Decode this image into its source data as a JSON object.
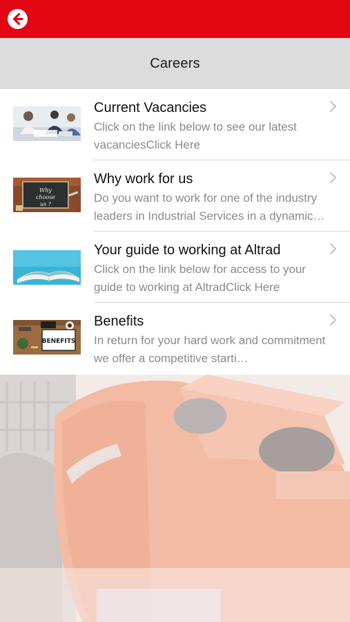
{
  "header": {
    "back_icon": "back-arrow-icon",
    "brand_color": "#e30613"
  },
  "page": {
    "title": "Careers"
  },
  "items": [
    {
      "title": "Current Vacancies",
      "description": "Click on the link below to see our latest vacanciesClick Here",
      "thumb": "meeting-photo"
    },
    {
      "title": "Why work for us",
      "description": "Do you want to work for one of the industry leaders in Industrial Services in a dynamic…",
      "thumb": "chalkboard-photo",
      "thumb_text": "Why choose us ?"
    },
    {
      "title": "Your guide to working at Altrad",
      "description": "Click on the link below for access to your guide to working at AltradClick Here",
      "thumb": "open-book-photo"
    },
    {
      "title": "Benefits",
      "description": "In return for your hard work and commitment we offer a competitive starti…",
      "thumb": "benefits-desk-photo",
      "thumb_text": "BENEFITS"
    }
  ],
  "icons": {
    "chevron": "chevron-right-icon"
  }
}
